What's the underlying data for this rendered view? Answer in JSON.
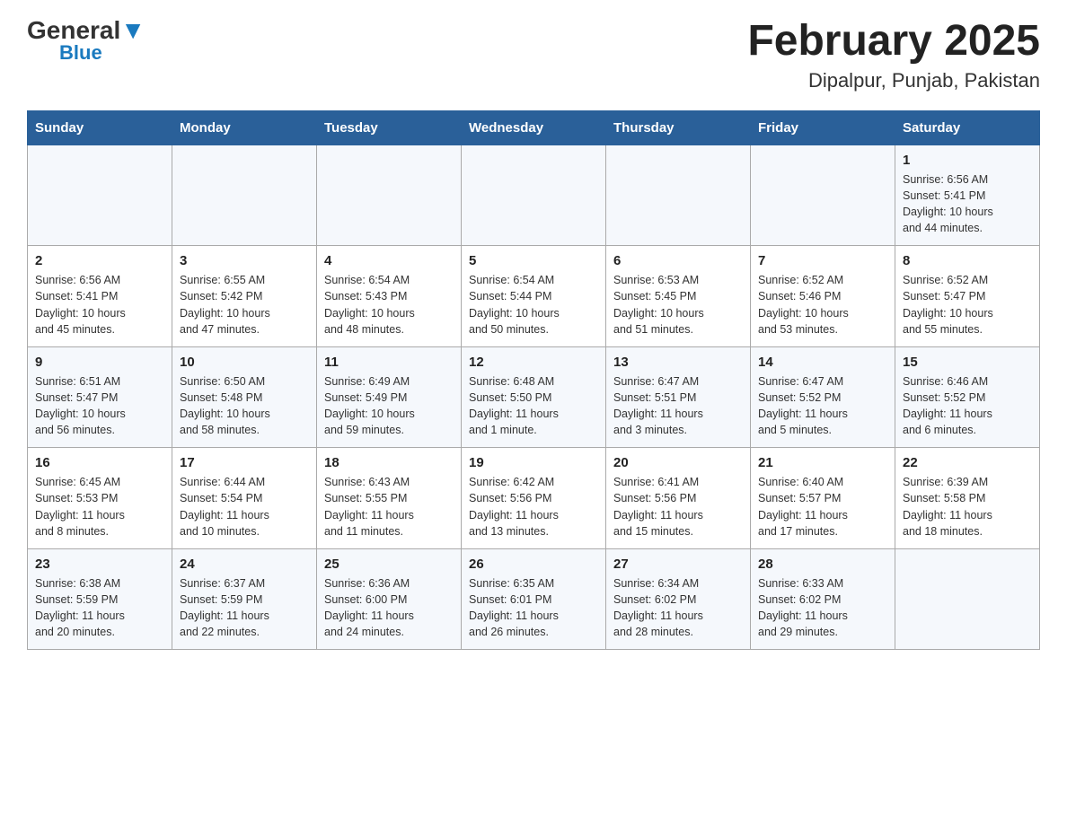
{
  "header": {
    "logo_general": "General",
    "logo_blue": "Blue",
    "title": "February 2025",
    "subtitle": "Dipalpur, Punjab, Pakistan"
  },
  "days_of_week": [
    "Sunday",
    "Monday",
    "Tuesday",
    "Wednesday",
    "Thursday",
    "Friday",
    "Saturday"
  ],
  "weeks": [
    {
      "days": [
        {
          "num": "",
          "info": ""
        },
        {
          "num": "",
          "info": ""
        },
        {
          "num": "",
          "info": ""
        },
        {
          "num": "",
          "info": ""
        },
        {
          "num": "",
          "info": ""
        },
        {
          "num": "",
          "info": ""
        },
        {
          "num": "1",
          "info": "Sunrise: 6:56 AM\nSunset: 5:41 PM\nDaylight: 10 hours\nand 44 minutes."
        }
      ]
    },
    {
      "days": [
        {
          "num": "2",
          "info": "Sunrise: 6:56 AM\nSunset: 5:41 PM\nDaylight: 10 hours\nand 45 minutes."
        },
        {
          "num": "3",
          "info": "Sunrise: 6:55 AM\nSunset: 5:42 PM\nDaylight: 10 hours\nand 47 minutes."
        },
        {
          "num": "4",
          "info": "Sunrise: 6:54 AM\nSunset: 5:43 PM\nDaylight: 10 hours\nand 48 minutes."
        },
        {
          "num": "5",
          "info": "Sunrise: 6:54 AM\nSunset: 5:44 PM\nDaylight: 10 hours\nand 50 minutes."
        },
        {
          "num": "6",
          "info": "Sunrise: 6:53 AM\nSunset: 5:45 PM\nDaylight: 10 hours\nand 51 minutes."
        },
        {
          "num": "7",
          "info": "Sunrise: 6:52 AM\nSunset: 5:46 PM\nDaylight: 10 hours\nand 53 minutes."
        },
        {
          "num": "8",
          "info": "Sunrise: 6:52 AM\nSunset: 5:47 PM\nDaylight: 10 hours\nand 55 minutes."
        }
      ]
    },
    {
      "days": [
        {
          "num": "9",
          "info": "Sunrise: 6:51 AM\nSunset: 5:47 PM\nDaylight: 10 hours\nand 56 minutes."
        },
        {
          "num": "10",
          "info": "Sunrise: 6:50 AM\nSunset: 5:48 PM\nDaylight: 10 hours\nand 58 minutes."
        },
        {
          "num": "11",
          "info": "Sunrise: 6:49 AM\nSunset: 5:49 PM\nDaylight: 10 hours\nand 59 minutes."
        },
        {
          "num": "12",
          "info": "Sunrise: 6:48 AM\nSunset: 5:50 PM\nDaylight: 11 hours\nand 1 minute."
        },
        {
          "num": "13",
          "info": "Sunrise: 6:47 AM\nSunset: 5:51 PM\nDaylight: 11 hours\nand 3 minutes."
        },
        {
          "num": "14",
          "info": "Sunrise: 6:47 AM\nSunset: 5:52 PM\nDaylight: 11 hours\nand 5 minutes."
        },
        {
          "num": "15",
          "info": "Sunrise: 6:46 AM\nSunset: 5:52 PM\nDaylight: 11 hours\nand 6 minutes."
        }
      ]
    },
    {
      "days": [
        {
          "num": "16",
          "info": "Sunrise: 6:45 AM\nSunset: 5:53 PM\nDaylight: 11 hours\nand 8 minutes."
        },
        {
          "num": "17",
          "info": "Sunrise: 6:44 AM\nSunset: 5:54 PM\nDaylight: 11 hours\nand 10 minutes."
        },
        {
          "num": "18",
          "info": "Sunrise: 6:43 AM\nSunset: 5:55 PM\nDaylight: 11 hours\nand 11 minutes."
        },
        {
          "num": "19",
          "info": "Sunrise: 6:42 AM\nSunset: 5:56 PM\nDaylight: 11 hours\nand 13 minutes."
        },
        {
          "num": "20",
          "info": "Sunrise: 6:41 AM\nSunset: 5:56 PM\nDaylight: 11 hours\nand 15 minutes."
        },
        {
          "num": "21",
          "info": "Sunrise: 6:40 AM\nSunset: 5:57 PM\nDaylight: 11 hours\nand 17 minutes."
        },
        {
          "num": "22",
          "info": "Sunrise: 6:39 AM\nSunset: 5:58 PM\nDaylight: 11 hours\nand 18 minutes."
        }
      ]
    },
    {
      "days": [
        {
          "num": "23",
          "info": "Sunrise: 6:38 AM\nSunset: 5:59 PM\nDaylight: 11 hours\nand 20 minutes."
        },
        {
          "num": "24",
          "info": "Sunrise: 6:37 AM\nSunset: 5:59 PM\nDaylight: 11 hours\nand 22 minutes."
        },
        {
          "num": "25",
          "info": "Sunrise: 6:36 AM\nSunset: 6:00 PM\nDaylight: 11 hours\nand 24 minutes."
        },
        {
          "num": "26",
          "info": "Sunrise: 6:35 AM\nSunset: 6:01 PM\nDaylight: 11 hours\nand 26 minutes."
        },
        {
          "num": "27",
          "info": "Sunrise: 6:34 AM\nSunset: 6:02 PM\nDaylight: 11 hours\nand 28 minutes."
        },
        {
          "num": "28",
          "info": "Sunrise: 6:33 AM\nSunset: 6:02 PM\nDaylight: 11 hours\nand 29 minutes."
        },
        {
          "num": "",
          "info": ""
        }
      ]
    }
  ]
}
